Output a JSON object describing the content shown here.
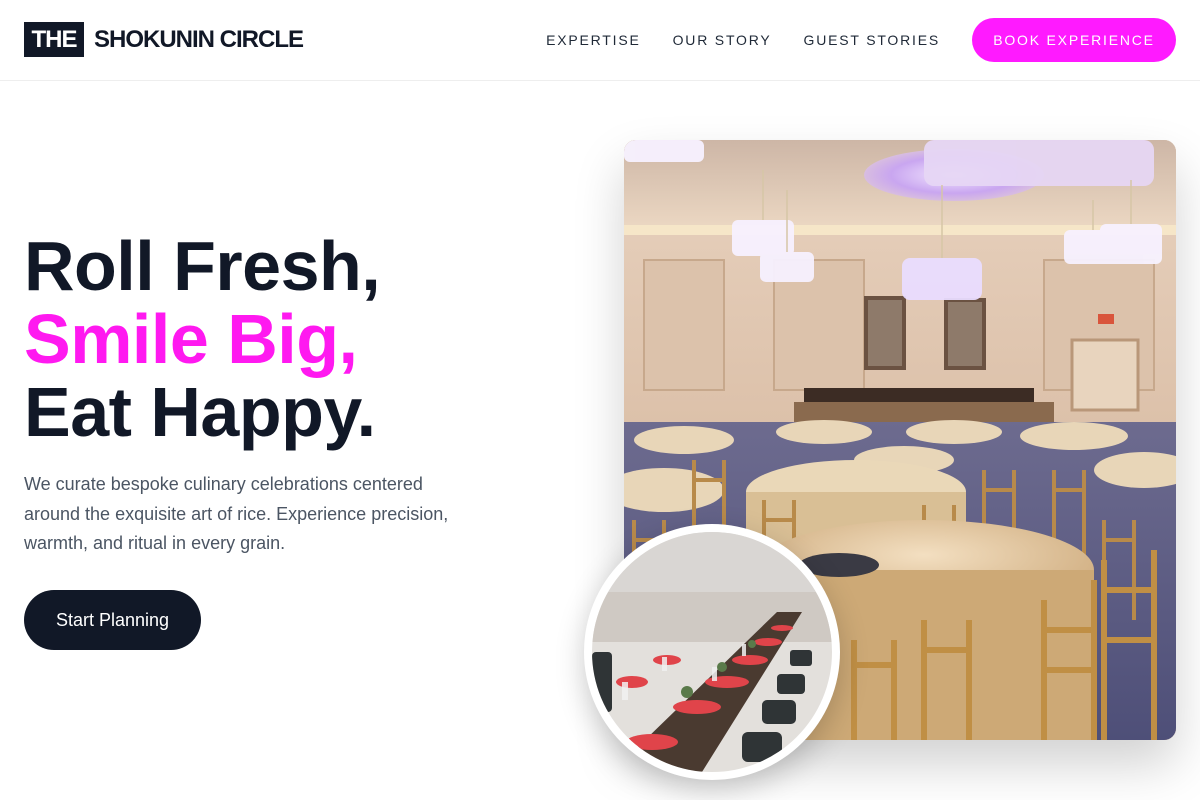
{
  "brand": {
    "mark": "THE",
    "name": "SHOKUNIN CIRCLE"
  },
  "nav": {
    "links": [
      "EXPERTISE",
      "OUR STORY",
      "GUEST STORIES"
    ],
    "cta": "BOOK EXPERIENCE"
  },
  "hero": {
    "line1": "Roll Fresh,",
    "line2": "Smile Big,",
    "line3": "Eat Happy.",
    "description": "We curate bespoke culinary celebrations centered around the exquisite art of rice. Experience precision, warmth, and ritual in every grain.",
    "cta": "Start Planning"
  },
  "colors": {
    "accent": "#ff1aff",
    "dark": "#111827",
    "muted": "#4b5563"
  }
}
